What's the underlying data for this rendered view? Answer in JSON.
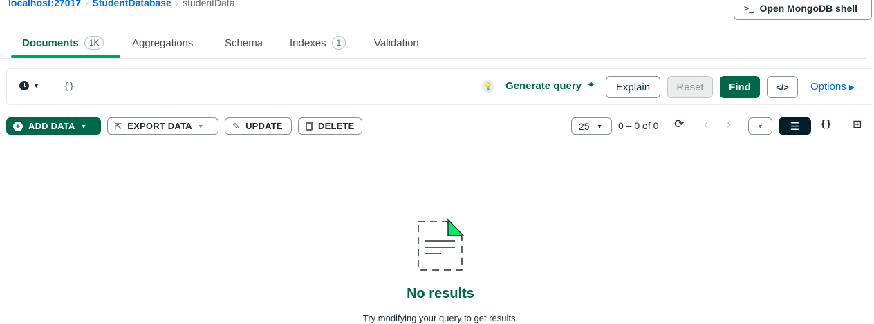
{
  "breadcrumb": {
    "host": "localhost:27017",
    "database": "StudentDatabase",
    "collection": "studentData",
    "separator": "›"
  },
  "shell_button": {
    "label": "Open MongoDB shell",
    "icon": ">_"
  },
  "tabs": [
    {
      "label": "Documents",
      "count": "1K",
      "active": true
    },
    {
      "label": "Aggregations"
    },
    {
      "label": "Schema"
    },
    {
      "label": "Indexes",
      "count": "1"
    },
    {
      "label": "Validation"
    }
  ],
  "query_bar": {
    "filter": "{}",
    "generate_query": "Generate query",
    "buttons": {
      "explain": "Explain",
      "reset": "Reset",
      "find": "Find",
      "code": "</>"
    },
    "options": "Options"
  },
  "toolbar": {
    "add_data": "ADD DATA",
    "export_data": "EXPORT DATA",
    "update": "UPDATE",
    "delete": "DELETE",
    "page_size": "25",
    "page_range": "0 – 0 of 0",
    "view_json": "{}"
  },
  "empty_state": {
    "title": "No results",
    "subtitle": "Try modifying your query to get results."
  },
  "colors": {
    "brand_green": "#00684a",
    "tab_underline": "#00a35c",
    "link_blue": "#016bf8",
    "dark": "#001e2b"
  }
}
